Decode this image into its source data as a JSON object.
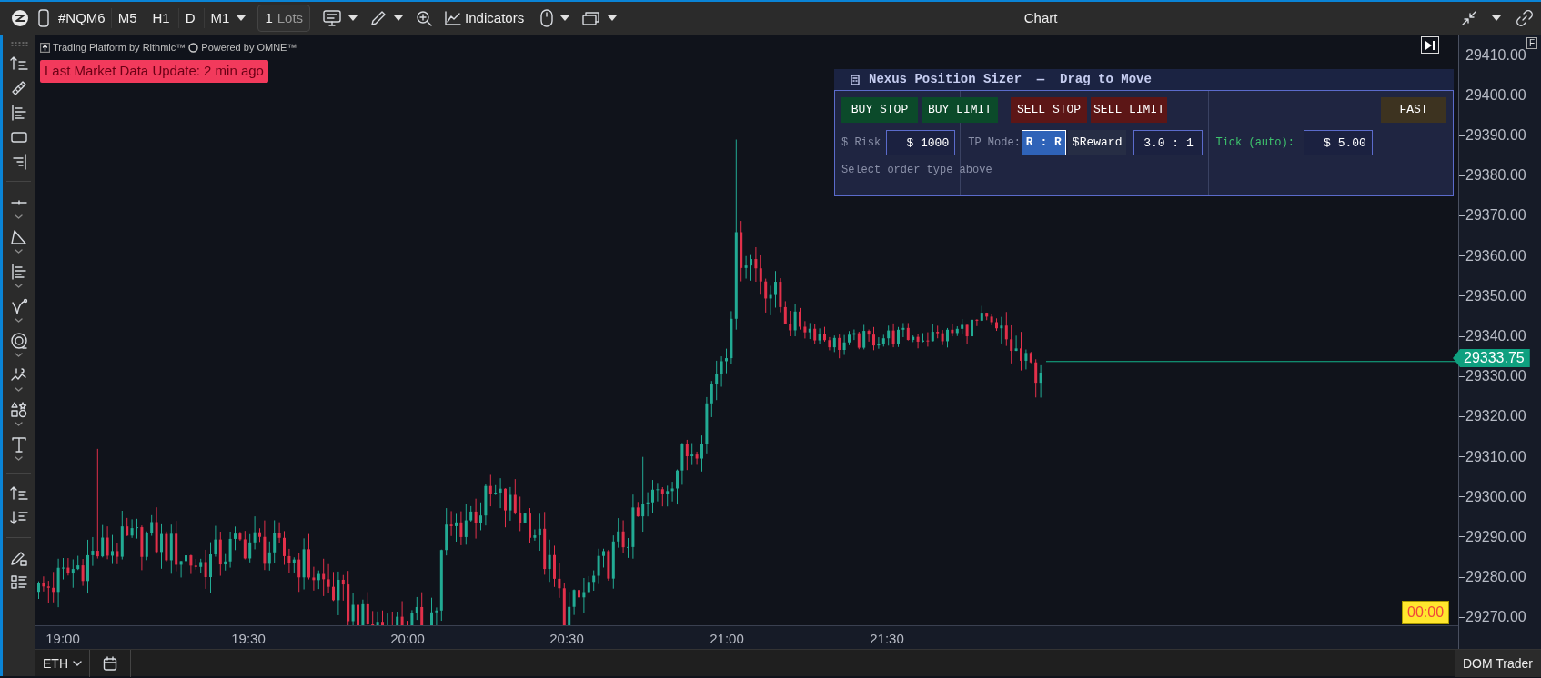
{
  "window": {
    "title": "Chart"
  },
  "toolbar": {
    "symbol": "#NQM6",
    "timeframes": [
      {
        "label": "M5",
        "dropdown": false
      },
      {
        "label": "H1",
        "dropdown": false
      },
      {
        "label": "D",
        "dropdown": false
      },
      {
        "label": "M1",
        "dropdown": true
      }
    ],
    "lots": {
      "value": "1",
      "unit": "Lots"
    },
    "indicators": "Indicators"
  },
  "chart": {
    "branding": "Trading Platform by Rithmic™",
    "powered_by": "Powered by OMNE™",
    "alert": "Last Market Data Update: 2 min ago",
    "scale_mode": "F",
    "price_labels": [
      "29410.00",
      "29400.00",
      "29390.00",
      "29380.00",
      "29370.00",
      "29360.00",
      "29350.00",
      "29340.00",
      "29330.00",
      "29320.00",
      "29310.00",
      "29300.00",
      "29290.00",
      "29280.00",
      "29270.00"
    ],
    "time_labels": [
      "19:00",
      "19:30",
      "20:00",
      "20:30",
      "21:00",
      "21:30"
    ],
    "current_price": "29333.75",
    "timer": "00:00"
  },
  "position_sizer": {
    "title": "Nexus Position Sizer  —  Drag to Move",
    "order_buttons": [
      {
        "label": "BUY STOP",
        "kind": "buy"
      },
      {
        "label": "BUY LIMIT",
        "kind": "buy"
      },
      {
        "label": "SELL STOP",
        "kind": "sell"
      },
      {
        "label": "SELL LIMIT",
        "kind": "sell"
      }
    ],
    "fast_button": "FAST",
    "risk": {
      "label": "$ Risk",
      "value": "$ 1000"
    },
    "tp_mode": {
      "label": "TP Mode:",
      "options": [
        {
          "label": "R : R",
          "selected": true
        },
        {
          "label": "$Reward",
          "selected": false
        }
      ]
    },
    "ratio": "3.0 : 1",
    "tick": {
      "label": "Tick (auto):",
      "value": "$ 5.00"
    },
    "hint": "Select order type above"
  },
  "bottom_bar": {
    "session": "ETH",
    "dom_button": "DOM Trader"
  }
}
